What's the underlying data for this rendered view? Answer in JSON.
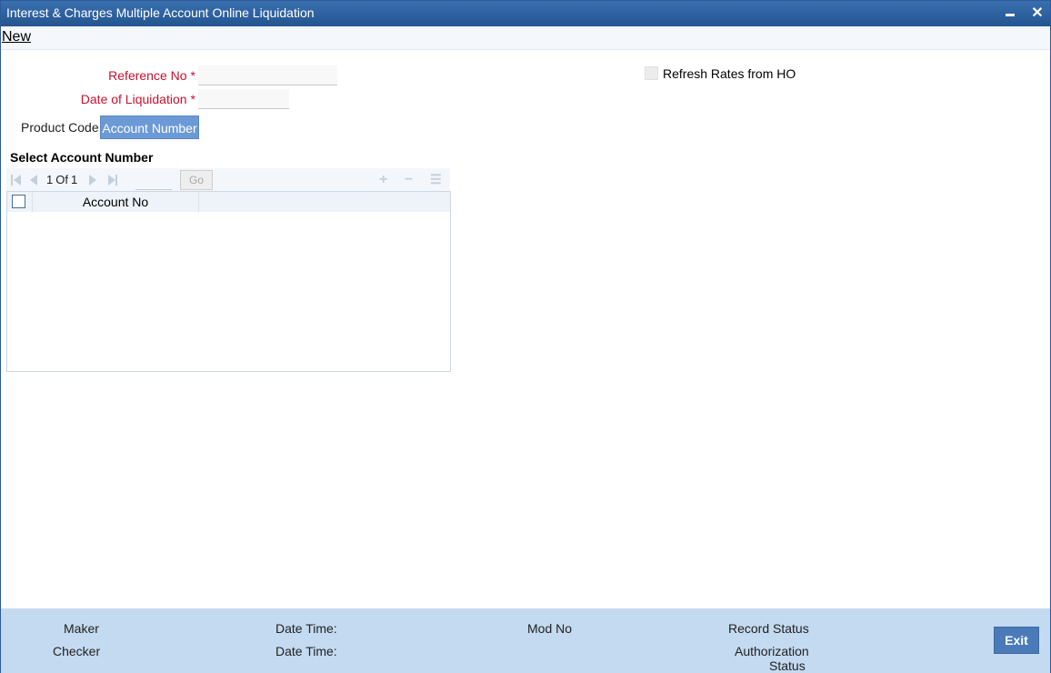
{
  "window": {
    "title": "Interest & Charges Multiple Account Online Liquidation"
  },
  "menu": {
    "new_label": "New"
  },
  "form": {
    "reference_no_label": "Reference No",
    "reference_no_value": "",
    "date_of_liquidation_label": "Date of Liquidation",
    "date_of_liquidation_value": "",
    "required_marker": "*",
    "refresh_rates_label": "Refresh Rates from HO",
    "refresh_rates_checked": false
  },
  "tabs": [
    {
      "label": "Product Code",
      "active": false
    },
    {
      "label": "Account Number",
      "active": true
    }
  ],
  "account_section": {
    "title": "Select Account Number",
    "pager": {
      "current": "1",
      "of_label": "Of",
      "total": "1"
    },
    "go_label": "Go",
    "columns": [
      "Account No"
    ],
    "rows": []
  },
  "footer": {
    "maker_label": "Maker",
    "checker_label": "Checker",
    "date_time_label": "Date Time:",
    "mod_no_label": "Mod No",
    "record_status_label": "Record Status",
    "authorization_label": "Authorization",
    "status_label": "Status",
    "exit_label": "Exit"
  },
  "colors": {
    "titlebar": "#23558f",
    "active_tab": "#6c9ad6",
    "required_label": "#c8102e",
    "footer": "#c4daf0",
    "exit_button": "#4a7bb8"
  }
}
